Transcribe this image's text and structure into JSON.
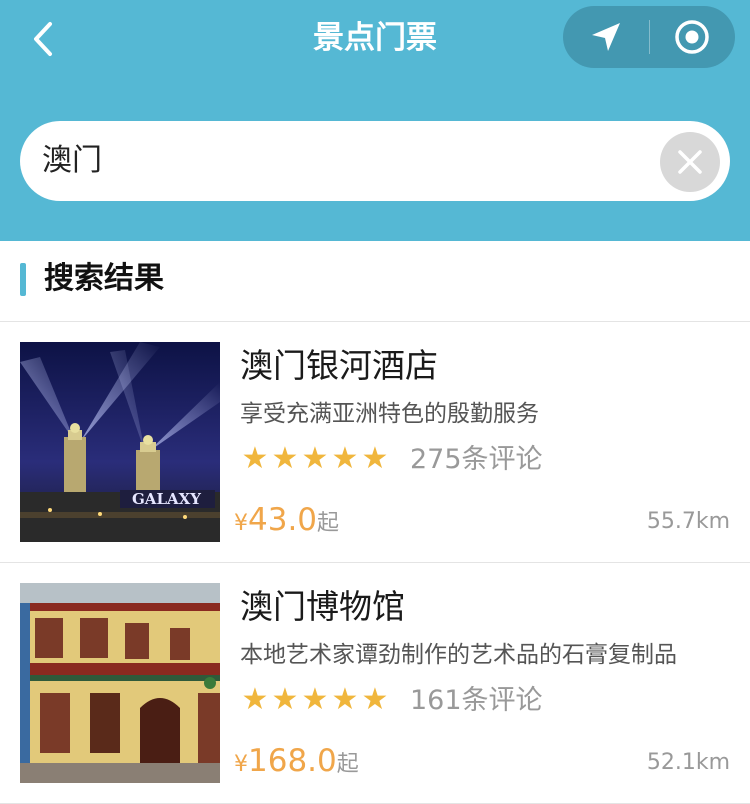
{
  "header": {
    "title": "景点门票",
    "back_icon": "chevron-left-icon",
    "location_icon": "navigation-arrow-icon",
    "target_icon": "target-circle-icon"
  },
  "search": {
    "value": "澳门",
    "clear_icon": "clear-x-icon"
  },
  "section": {
    "title": "搜索结果"
  },
  "results": [
    {
      "name": "澳门银河酒店",
      "description": "享受充满亚洲特色的殷勤服务",
      "rating": 5,
      "reviews": "275条评论",
      "currency": "¥",
      "price": "43.0",
      "price_suffix": "起",
      "distance": "55.7km"
    },
    {
      "name": "澳门博物馆",
      "description": "本地艺术家谭劲制作的艺术品的石膏复制品",
      "rating": 5,
      "reviews": "161条评论",
      "currency": "¥",
      "price": "168.0",
      "price_suffix": "起",
      "distance": "52.1km"
    }
  ],
  "colors": {
    "header_bg": "#55b8d4",
    "accent": "#55b8d4",
    "star": "#f0b63c",
    "price": "#f0a64a"
  }
}
